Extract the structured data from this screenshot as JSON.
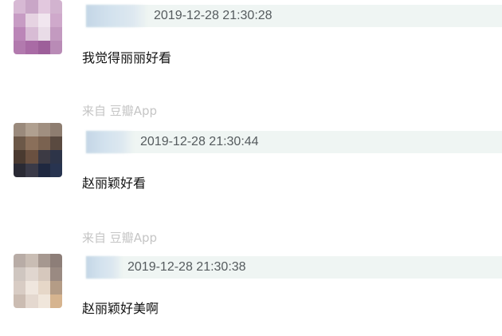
{
  "comments": [
    {
      "timestamp": "2019-12-28 21:30:28",
      "text": "我觉得丽丽好看"
    },
    {
      "source": "来自 豆瓣App",
      "timestamp": "2019-12-28 21:30:44",
      "text": "赵丽颖好看"
    },
    {
      "source": "来自 豆瓣App",
      "timestamp": "2019-12-28 21:30:38",
      "text": "赵丽颖好美啊"
    }
  ]
}
